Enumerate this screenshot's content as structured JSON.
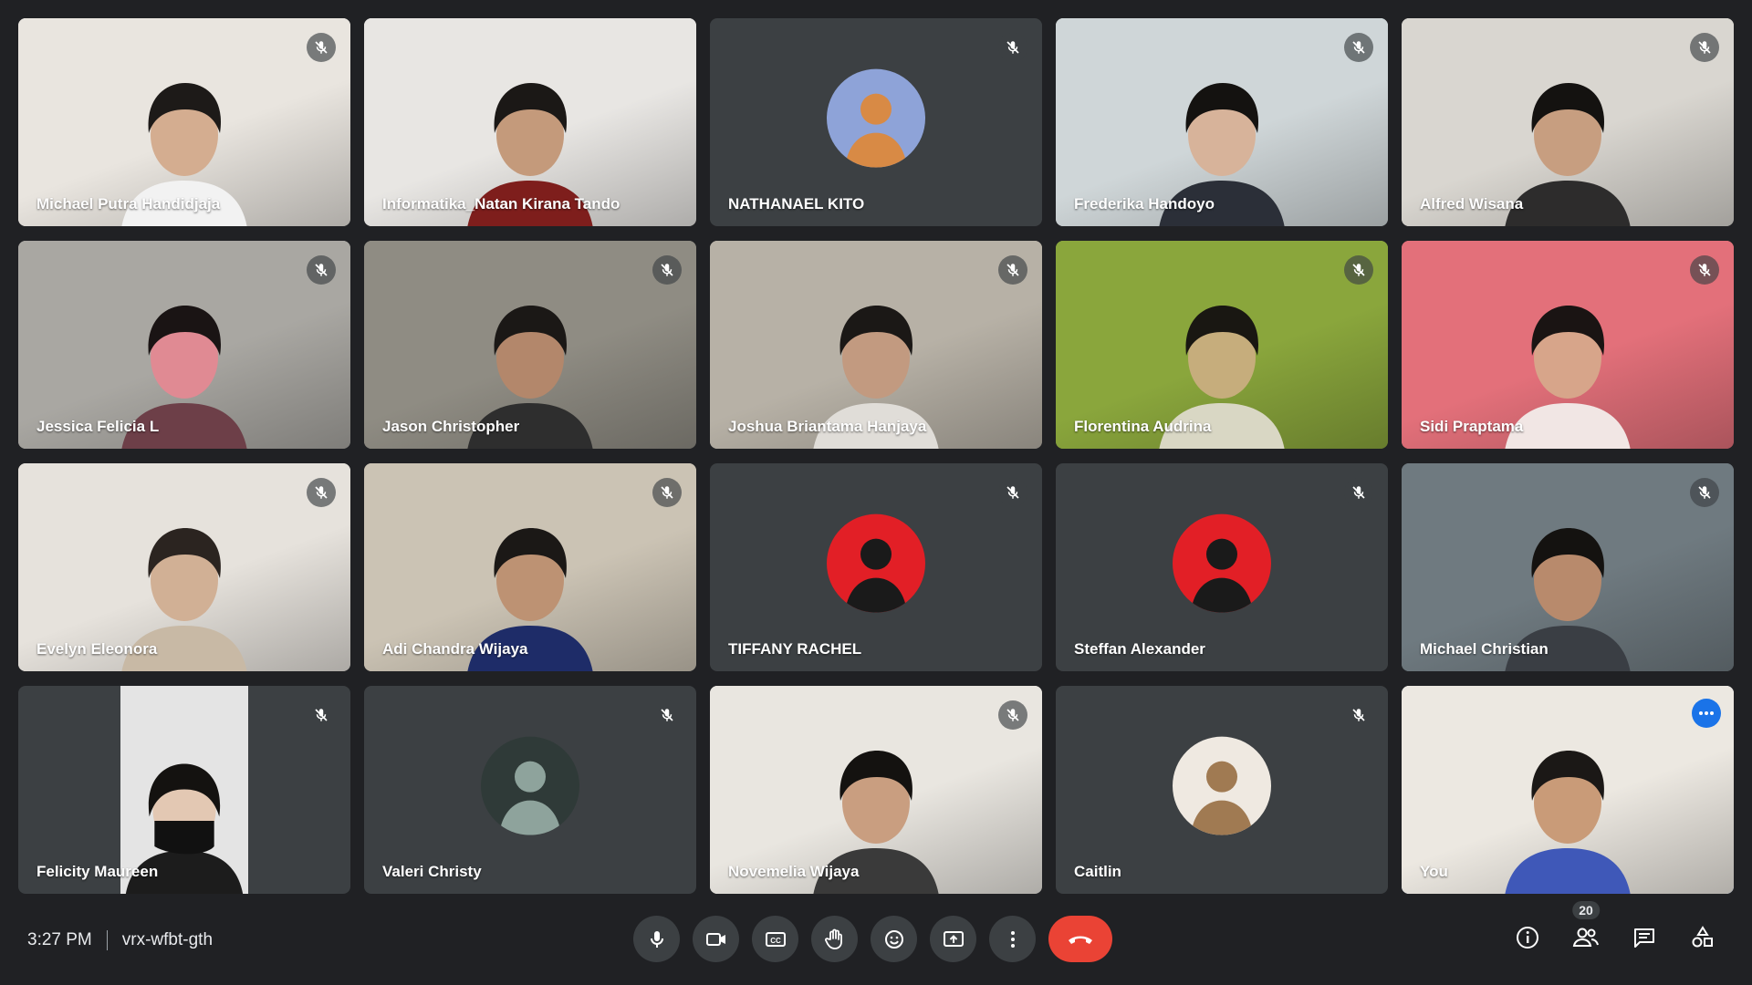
{
  "participants": [
    {
      "name": "Michael Putra Handidjaja",
      "kind": "video",
      "bg": "#e9e5df",
      "skin": "#d4ad90",
      "hair": "#1d1a18",
      "shirt": "#f2f2f2",
      "muted": true
    },
    {
      "name": "Informatika_Natan Kirana Tando",
      "kind": "video",
      "bg": "#e8e6e3",
      "skin": "#c49a7b",
      "hair": "#1b1816",
      "shirt": "#7e1e1c",
      "muted": false
    },
    {
      "name": "NATHANAEL KITO",
      "kind": "avatar",
      "avatar_bg": "#8ea3d8",
      "avatar_fg": "#d88a45",
      "muted": true
    },
    {
      "name": "Frederika Handoyo",
      "kind": "video",
      "bg": "#cfd6d8",
      "skin": "#d7b39a",
      "hair": "#141210",
      "shirt": "#2b2f38",
      "muted": true
    },
    {
      "name": "Alfred Wisana",
      "kind": "video",
      "bg": "#d9d6d0",
      "skin": "#c79e80",
      "hair": "#141210",
      "shirt": "#2d2c2c",
      "muted": true
    },
    {
      "name": "Jessica Felicia L",
      "kind": "video",
      "bg": "#a9a7a2",
      "skin": "#e08a93",
      "hair": "#1a1414",
      "shirt": "#6d3f48",
      "muted": true
    },
    {
      "name": "Jason Christopher",
      "kind": "video",
      "bg": "#8f8c83",
      "skin": "#b3876b",
      "hair": "#1b1816",
      "shirt": "#2e2e2e",
      "muted": true
    },
    {
      "name": "Joshua Briantama Hanjaya",
      "kind": "video",
      "bg": "#b7b1a6",
      "skin": "#c29a80",
      "hair": "#1b1816",
      "shirt": "#e0ddd8",
      "muted": true
    },
    {
      "name": "Florentina Audrina",
      "kind": "video",
      "bg": "#8aa63c",
      "skin": "#c6ad7c",
      "hair": "#191712",
      "shirt": "#d9d7c4",
      "muted": true
    },
    {
      "name": "Sidi Praptama",
      "kind": "video",
      "bg": "#e3707a",
      "skin": "#d7a58a",
      "hair": "#1a1413",
      "shirt": "#f1e6e4",
      "muted": true
    },
    {
      "name": "Evelyn Eleonora",
      "kind": "video",
      "bg": "#e6e2dc",
      "skin": "#d1b095",
      "hair": "#2b2420",
      "shirt": "#c8b9a5",
      "muted": true
    },
    {
      "name": "Adi Chandra Wijaya",
      "kind": "video",
      "bg": "#cbc3b4",
      "skin": "#bd9273",
      "hair": "#1b1816",
      "shirt": "#1e2c68",
      "muted": true
    },
    {
      "name": "TIFFANY RACHEL",
      "kind": "avatar",
      "avatar_bg": "#e21f26",
      "avatar_fg": "#1a1a1a",
      "muted": true
    },
    {
      "name": "Steffan Alexander",
      "kind": "avatar",
      "avatar_bg": "#e21f26",
      "avatar_fg": "#1a1a1a",
      "muted": true
    },
    {
      "name": "Michael Christian",
      "kind": "video",
      "bg": "#6f7a80",
      "skin": "#b88a6c",
      "hair": "#141210",
      "shirt": "#3a3e44",
      "muted": true
    },
    {
      "name": "Felicity Maureen",
      "kind": "video-narrow",
      "bg": "#e4e4e4",
      "skin": "#e3c8b3",
      "hair": "#141210",
      "shirt": "#1c1c1c",
      "muted": true
    },
    {
      "name": "Valeri Christy",
      "kind": "avatar",
      "avatar_bg": "#2f3a38",
      "avatar_fg": "#8ea39c",
      "muted": true
    },
    {
      "name": "Novemelia Wijaya",
      "kind": "video",
      "bg": "#e9e6e0",
      "skin": "#c99e80",
      "hair": "#141210",
      "shirt": "#3a3a3a",
      "muted": true
    },
    {
      "name": "Caitlin",
      "kind": "avatar",
      "avatar_bg": "#efe9e1",
      "avatar_fg": "#a07a52",
      "muted": true
    },
    {
      "name": "You",
      "kind": "video",
      "bg": "#ece8e1",
      "skin": "#c99b78",
      "hair": "#1b1816",
      "shirt": "#3f58b8",
      "muted": false,
      "self": true
    }
  ],
  "meeting": {
    "time": "3:27 PM",
    "code": "vrx-wfbt-gth",
    "participant_count": "20"
  },
  "controls": [
    {
      "name": "mic-button",
      "icon": "mic-icon"
    },
    {
      "name": "camera-button",
      "icon": "camera-icon"
    },
    {
      "name": "captions-button",
      "icon": "captions-icon"
    },
    {
      "name": "raise-hand-button",
      "icon": "hand-icon"
    },
    {
      "name": "reactions-button",
      "icon": "emoji-icon"
    },
    {
      "name": "present-button",
      "icon": "present-icon"
    },
    {
      "name": "more-options-button",
      "icon": "more-vert-icon"
    },
    {
      "name": "leave-call-button",
      "icon": "hangup-icon"
    }
  ],
  "colors": {
    "end_call": "#ea4335",
    "accent": "#8ab4f8",
    "surface": "#3c4043",
    "background": "#202124"
  }
}
